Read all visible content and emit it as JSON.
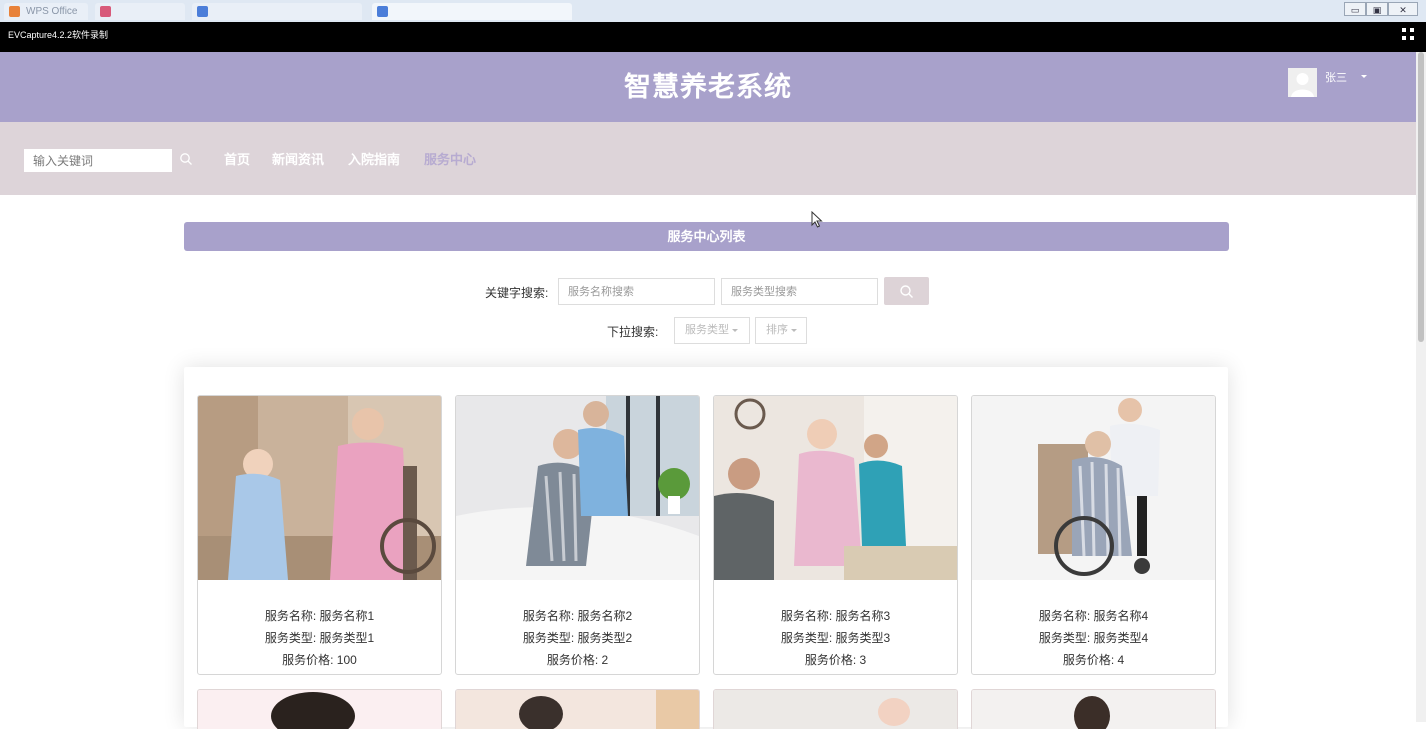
{
  "os": {
    "tabs": [
      "WPS Office",
      "",
      "",
      ""
    ],
    "controls": [
      "▭",
      "▣",
      "✕"
    ]
  },
  "recorder": {
    "title": "EVCapture4.2.2软件录制"
  },
  "header": {
    "title": "智慧养老系统",
    "user": "张三"
  },
  "nav": {
    "search_placeholder": "输入关键词",
    "links": [
      "首页",
      "新闻资讯",
      "入院指南",
      "服务中心"
    ],
    "active_color": "#b7abd1"
  },
  "list": {
    "title": "服务中心列表",
    "keyword_label": "关键字搜索:",
    "name_placeholder": "服务名称搜索",
    "type_placeholder": "服务类型搜索",
    "dropdown_label": "下拉搜索:",
    "dropdown_type": "服务类型",
    "dropdown_sort": "排序"
  },
  "cards": [
    {
      "name": "服务名称: 服务名称1",
      "type": "服务类型: 服务类型1",
      "price": "服务价格: 100"
    },
    {
      "name": "服务名称: 服务名称2",
      "type": "服务类型: 服务类型2",
      "price": "服务价格: 2"
    },
    {
      "name": "服务名称: 服务名称3",
      "type": "服务类型: 服务类型3",
      "price": "服务价格: 3"
    },
    {
      "name": "服务名称: 服务名称4",
      "type": "服务类型: 服务类型4",
      "price": "服务价格: 4"
    }
  ],
  "colors": {
    "header": "#a8a1cb",
    "nav": "#ddd4d9",
    "accent": "#a8a1cb"
  }
}
